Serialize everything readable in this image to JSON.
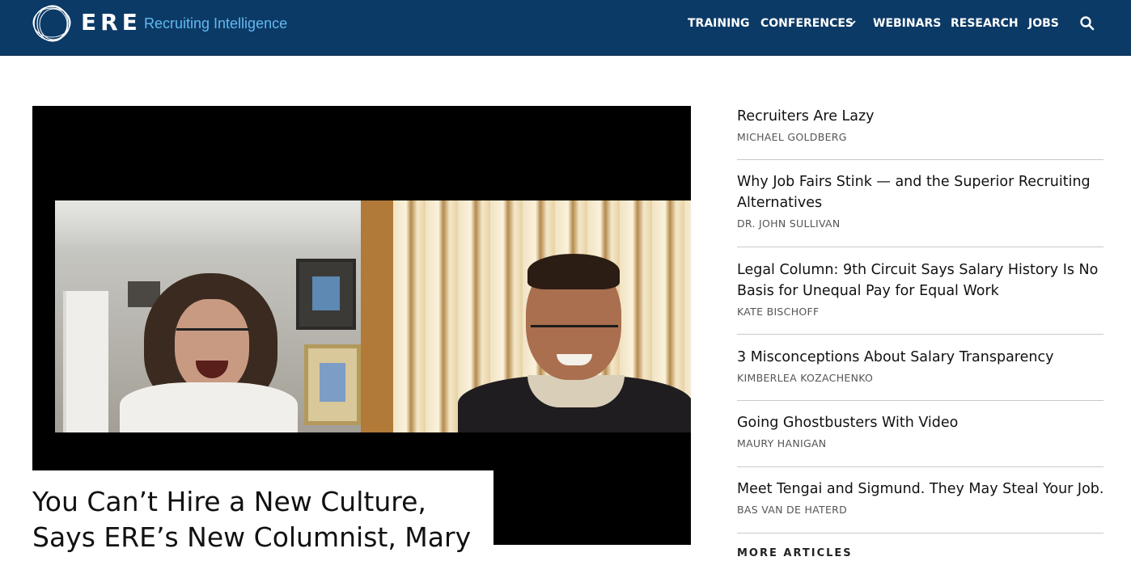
{
  "header": {
    "logo_text": "ERE",
    "tagline": "Recruiting Intelligence",
    "colors": {
      "background": "#0c3a66",
      "tagline": "#63b8f0",
      "nav_text": "#ffffff"
    },
    "nav": {
      "training": "TRAINING",
      "conferences": "CONFERENCES",
      "webinars": "WEBINARS",
      "research": "RESEARCH",
      "jobs": "JOBS"
    },
    "search_icon": "search-icon"
  },
  "hero": {
    "title": "You Can’t Hire a New Culture, Says ERE’s New Columnist, Mary"
  },
  "sidebar": {
    "articles": [
      {
        "title": "Recruiters Are Lazy",
        "author": "MICHAEL GOLDBERG"
      },
      {
        "title": "Why Job Fairs Stink — and the Superior Recruiting Alternatives",
        "author": "DR. JOHN SULLIVAN"
      },
      {
        "title": "Legal Column: 9th Circuit Says Salary History Is No Basis for Unequal Pay for Equal Work",
        "author": "KATE BISCHOFF"
      },
      {
        "title": "3 Misconceptions About Salary Transparency",
        "author": "KIMBERLEA KOZACHENKO"
      },
      {
        "title": "Going Ghostbusters With Video",
        "author": "MAURY HANIGAN"
      },
      {
        "title": "Meet Tengai and Sigmund. They May Steal Your Job.",
        "author": "BAS VAN DE HATERD"
      }
    ],
    "more_label": "MORE ARTICLES"
  }
}
